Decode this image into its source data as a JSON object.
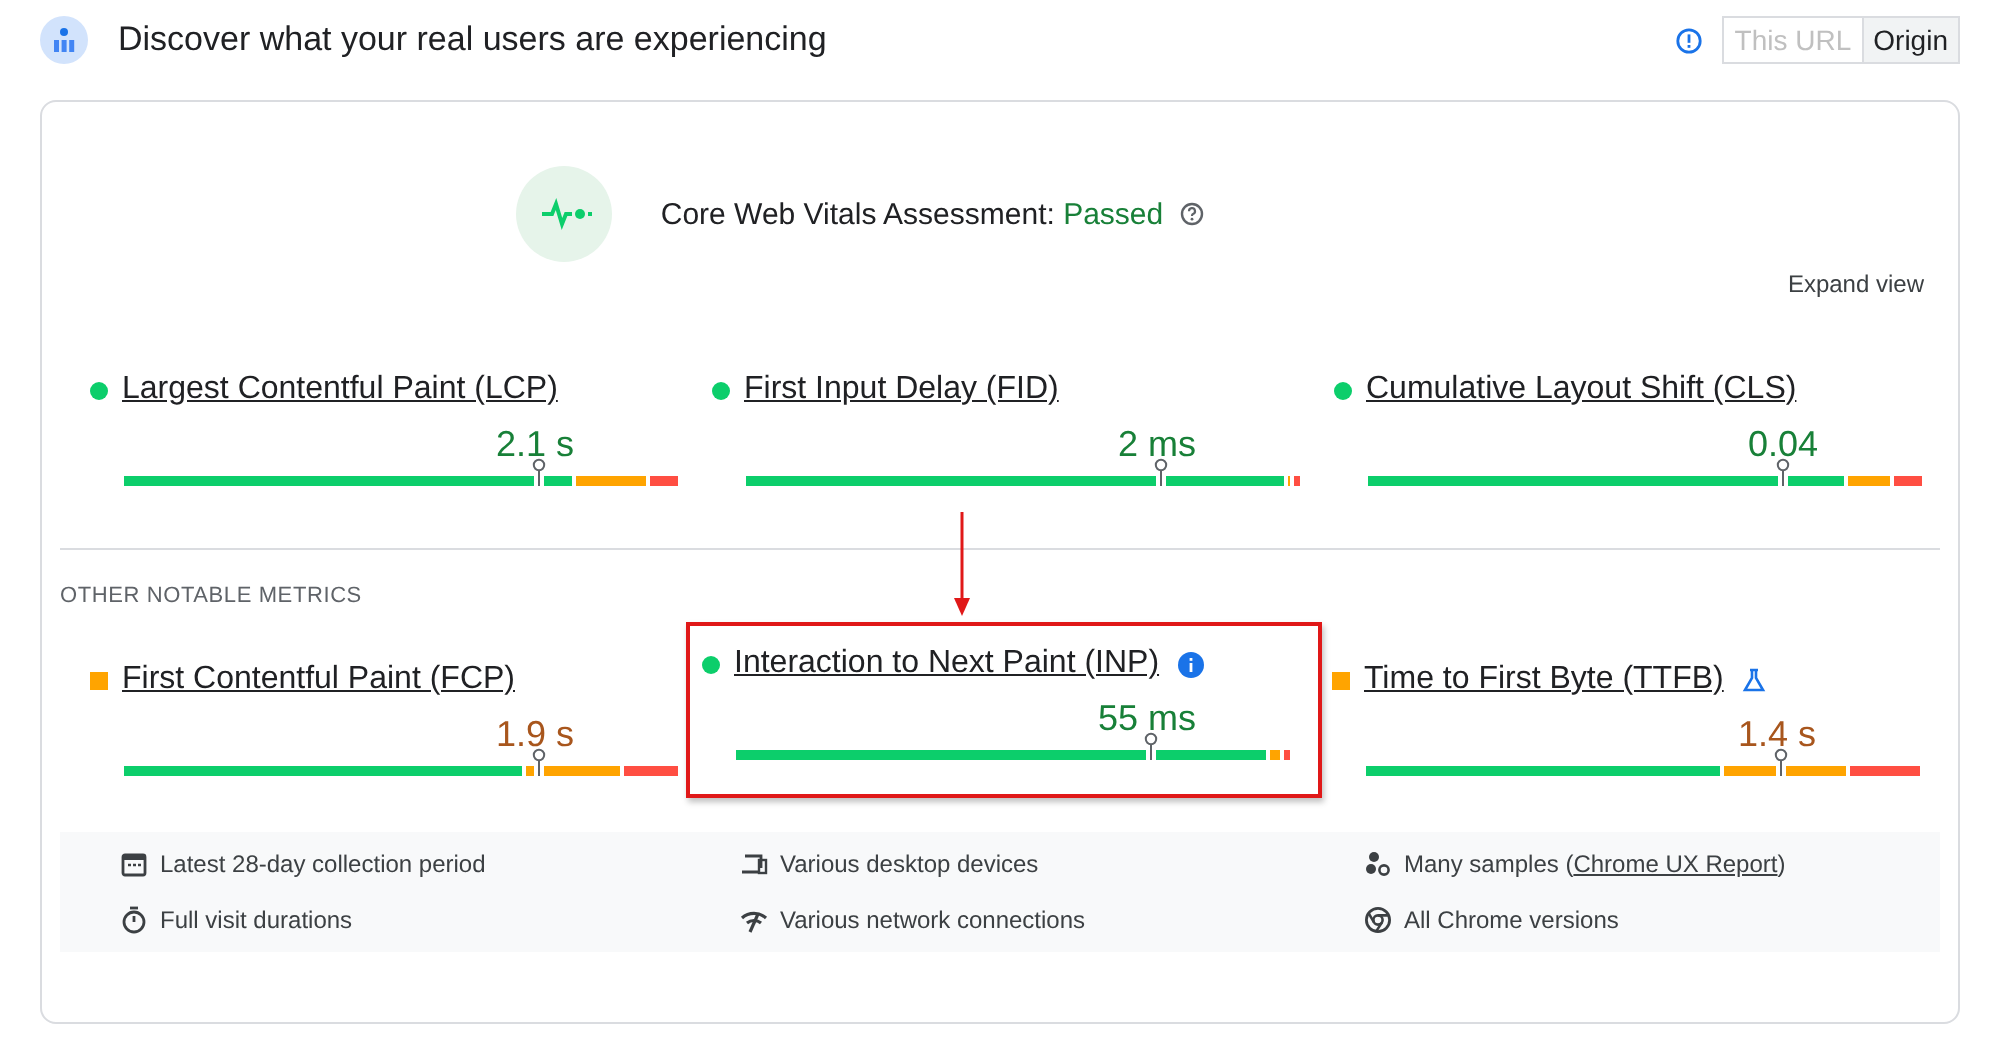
{
  "header": {
    "title": "Discover what your real users are experiencing",
    "scopes": [
      {
        "label": "This URL",
        "selected": false,
        "disabled": true
      },
      {
        "label": "Origin",
        "selected": true,
        "disabled": false
      }
    ]
  },
  "assessment": {
    "label": "Core Web Vitals Assessment:",
    "result": "Passed",
    "expand": "Expand view"
  },
  "core_metrics": [
    {
      "name": "Largest Contentful Paint (LCP)",
      "value": "2.1 s",
      "kind": "good",
      "info": false,
      "experimental": false,
      "highlighted": false
    },
    {
      "name": "First Input Delay (FID)",
      "value": "2 ms",
      "kind": "good",
      "info": false,
      "experimental": false,
      "highlighted": false
    },
    {
      "name": "Cumulative Layout Shift (CLS)",
      "value": "0.04",
      "kind": "good",
      "info": false,
      "experimental": false,
      "highlighted": false
    }
  ],
  "other_heading": "OTHER NOTABLE METRICS",
  "other_metrics": [
    {
      "name": "First Contentful Paint (FCP)",
      "value": "1.9 s",
      "kind": "average",
      "info": false,
      "experimental": false,
      "highlighted": false
    },
    {
      "name": "Interaction to Next Paint (INP)",
      "value": "55 ms",
      "kind": "good",
      "info": true,
      "experimental": false,
      "highlighted": true
    },
    {
      "name": "Time to First Byte (TTFB)",
      "value": "1.4 s",
      "kind": "average",
      "info": false,
      "experimental": true,
      "highlighted": false
    }
  ],
  "facts": [
    {
      "kind": "calendar",
      "text": "Latest 28-day collection period"
    },
    {
      "kind": "devices",
      "text": "Various desktop devices"
    },
    {
      "kind": "samples",
      "text": "Many samples (",
      "link": "Chrome UX Report",
      "after": ")"
    },
    {
      "kind": "timer",
      "text": "Full visit durations"
    },
    {
      "kind": "network",
      "text": "Various network connections"
    },
    {
      "kind": "chrome",
      "text": "All Chrome versions"
    }
  ]
}
